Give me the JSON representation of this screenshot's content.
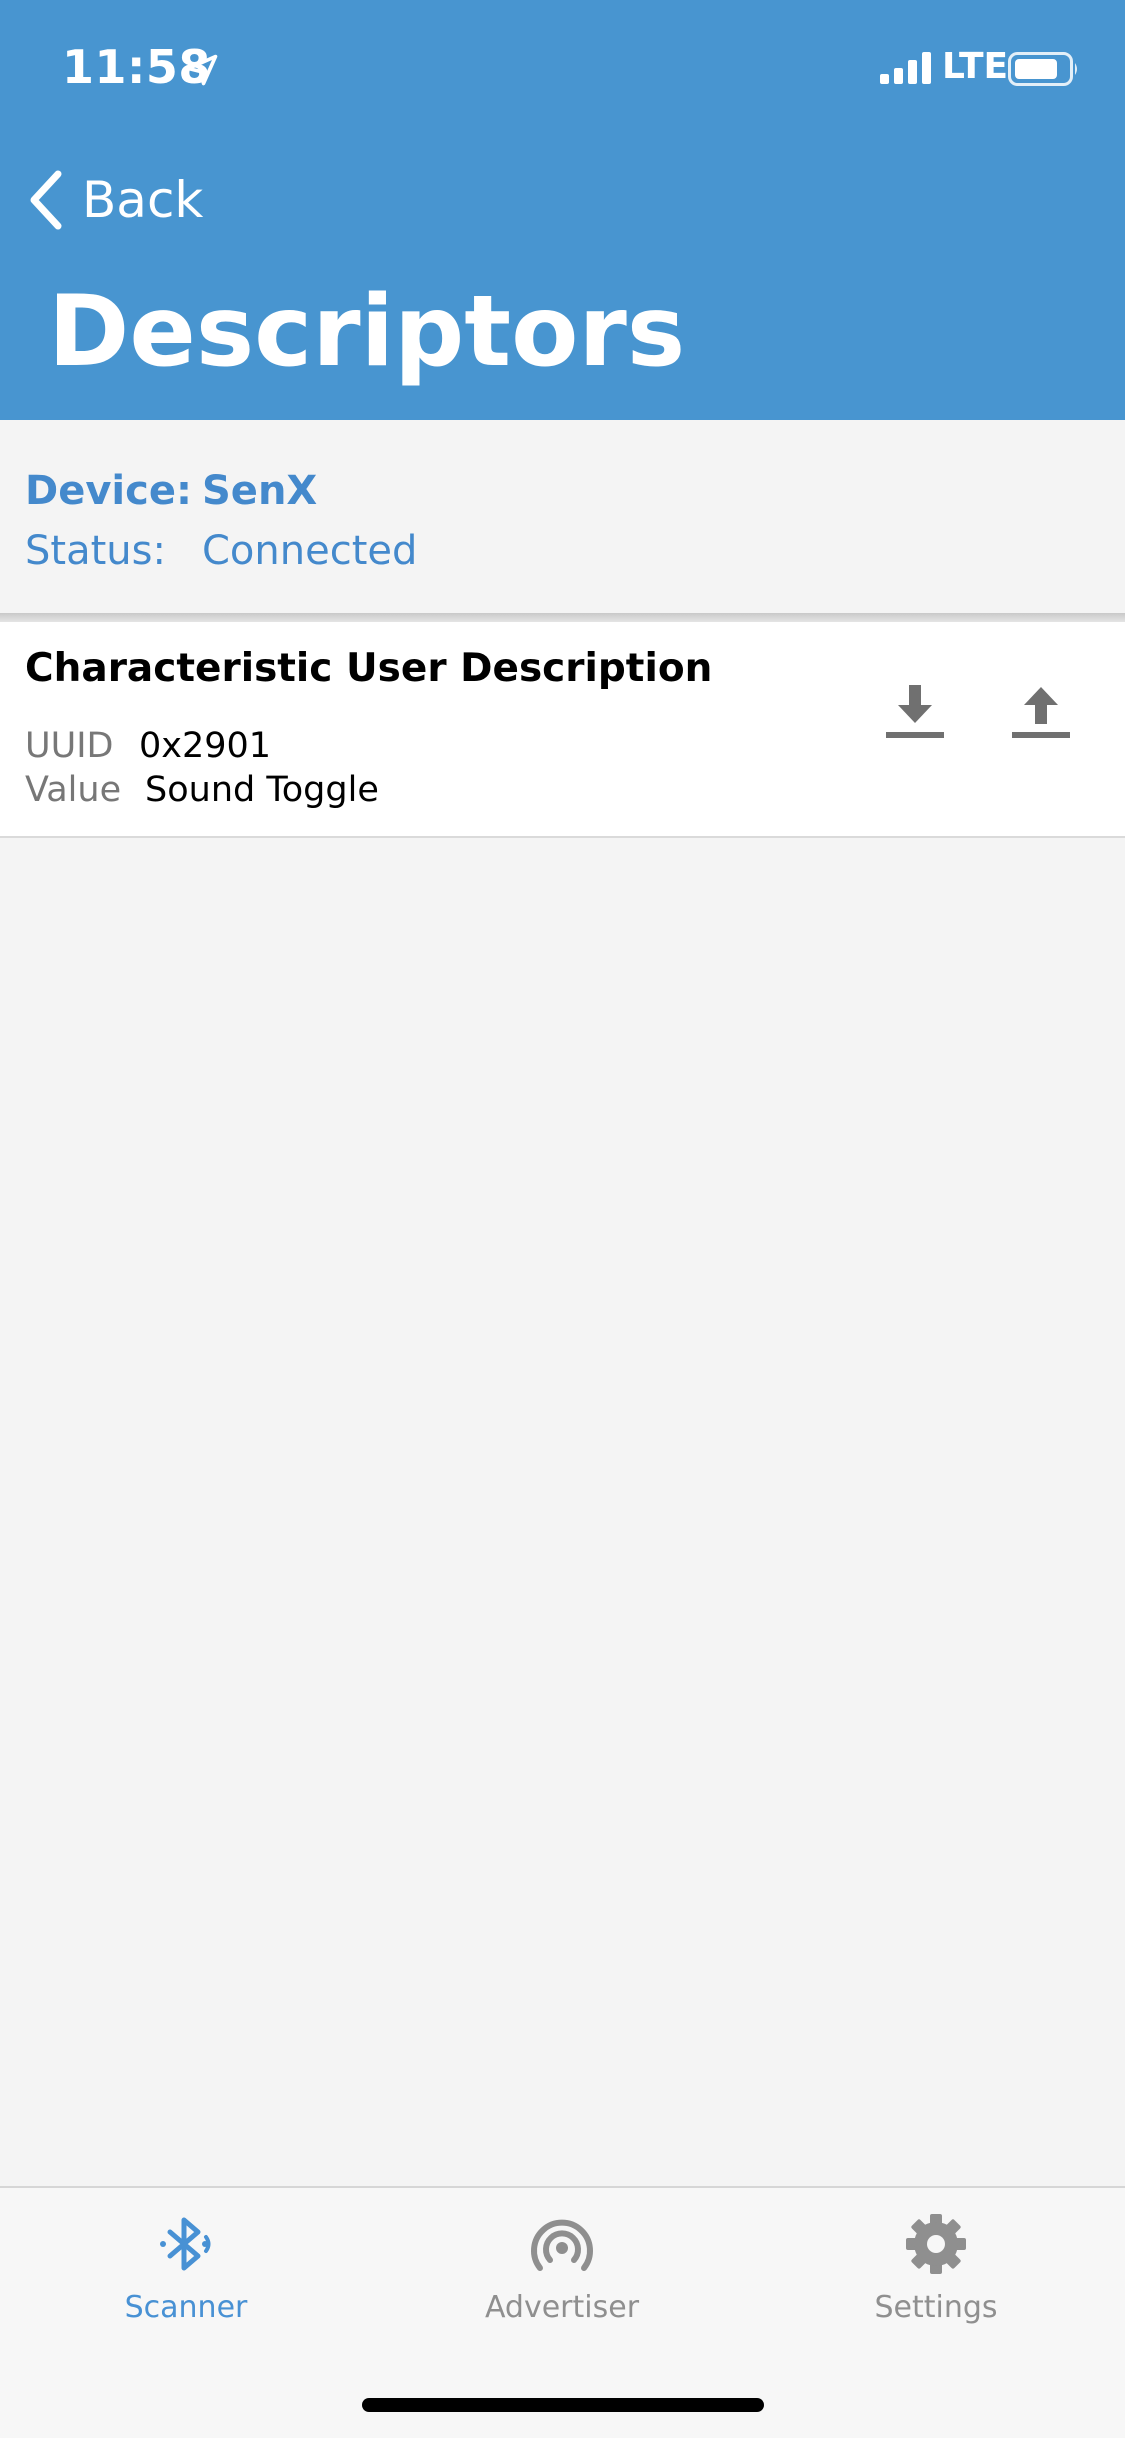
{
  "status_bar": {
    "time": "11:58",
    "carrier": "LTE",
    "icons": [
      "location-arrow-icon",
      "signal-bars-icon",
      "battery-icon"
    ]
  },
  "nav": {
    "back_label": "Back",
    "title": "Descriptors"
  },
  "device_info": {
    "device_key": "Device:",
    "device_value": "SenX",
    "status_key": "Status:",
    "status_value": "Connected"
  },
  "descriptors": [
    {
      "name": "Characteristic User Description",
      "uuid_label": "UUID",
      "uuid": "0x2901",
      "value_label": "Value",
      "value": "Sound Toggle",
      "actions": [
        "download-icon",
        "upload-icon"
      ]
    }
  ],
  "tabbar": {
    "tabs": [
      {
        "label": "Scanner",
        "icon": "bluetooth-icon",
        "active": true
      },
      {
        "label": "Advertiser",
        "icon": "broadcast-icon",
        "active": false
      },
      {
        "label": "Settings",
        "icon": "gear-icon",
        "active": false
      }
    ]
  },
  "colors": {
    "header": "#4895d0",
    "accent": "#4489cc",
    "inactive": "#8f8f8f"
  }
}
